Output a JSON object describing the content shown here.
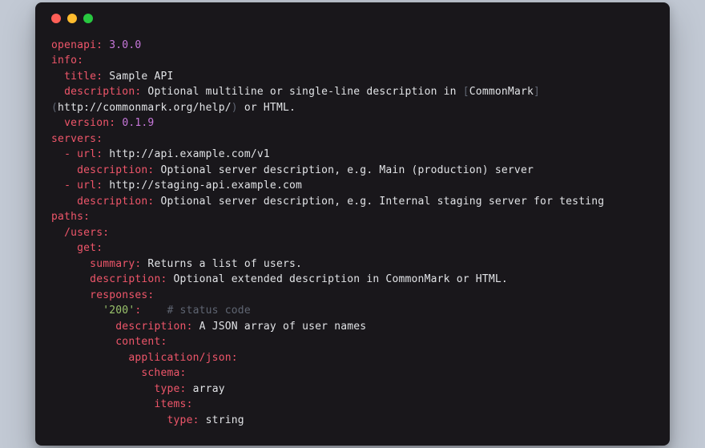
{
  "openapi_key": "openapi:",
  "openapi_val": "3.0.0",
  "info_key": "info:",
  "title_key": "title:",
  "title_val": "Sample API",
  "description_key": "description:",
  "info_desc_pre": "Optional multiline or single-line description in ",
  "info_desc_lb": "[",
  "info_desc_ltxt": "CommonMark",
  "info_desc_rb": "]",
  "info_desc_lp": "(",
  "info_desc_url": "http://commonmark.org/help/",
  "info_desc_rp": ")",
  "info_desc_post": " or HTML.",
  "version_key": "version:",
  "version_val": "0.1.9",
  "servers_key": "servers:",
  "dash_url_key": "- url:",
  "server1_url": "http://api.example.com/v1",
  "server1_desc": "Optional server description, e.g. Main (production) server",
  "server2_url": "http://staging-api.example.com",
  "server2_desc": "Optional server description, e.g. Internal staging server for testing",
  "paths_key": "paths:",
  "users_key": "/users:",
  "get_key": "get:",
  "summary_key": "summary:",
  "summary_val": "Returns a list of users.",
  "get_desc_val": "Optional extended description in CommonMark or HTML.",
  "responses_key": "responses:",
  "status200": "'200'",
  "status_colon": ":",
  "status_comment": "# status code",
  "resp_desc_val": "A JSON array of user names",
  "content_key": "content:",
  "appjson_key": "application/json:",
  "schema_key": "schema:",
  "type_key": "type:",
  "type_array": "array",
  "items_key": "items:",
  "type_string": "string",
  "chart_data": {
    "type": "table",
    "format": "openapi-yaml",
    "spec": {
      "openapi": "3.0.0",
      "info": {
        "title": "Sample API",
        "description": "Optional multiline or single-line description in [CommonMark](http://commonmark.org/help/) or HTML.",
        "version": "0.1.9"
      },
      "servers": [
        {
          "url": "http://api.example.com/v1",
          "description": "Optional server description, e.g. Main (production) server"
        },
        {
          "url": "http://staging-api.example.com",
          "description": "Optional server description, e.g. Internal staging server for testing"
        }
      ],
      "paths": {
        "/users": {
          "get": {
            "summary": "Returns a list of users.",
            "description": "Optional extended description in CommonMark or HTML.",
            "responses": {
              "200": {
                "description": "A JSON array of user names",
                "content": {
                  "application/json": {
                    "schema": {
                      "type": "array",
                      "items": {
                        "type": "string"
                      }
                    }
                  }
                }
              }
            }
          }
        }
      }
    }
  }
}
